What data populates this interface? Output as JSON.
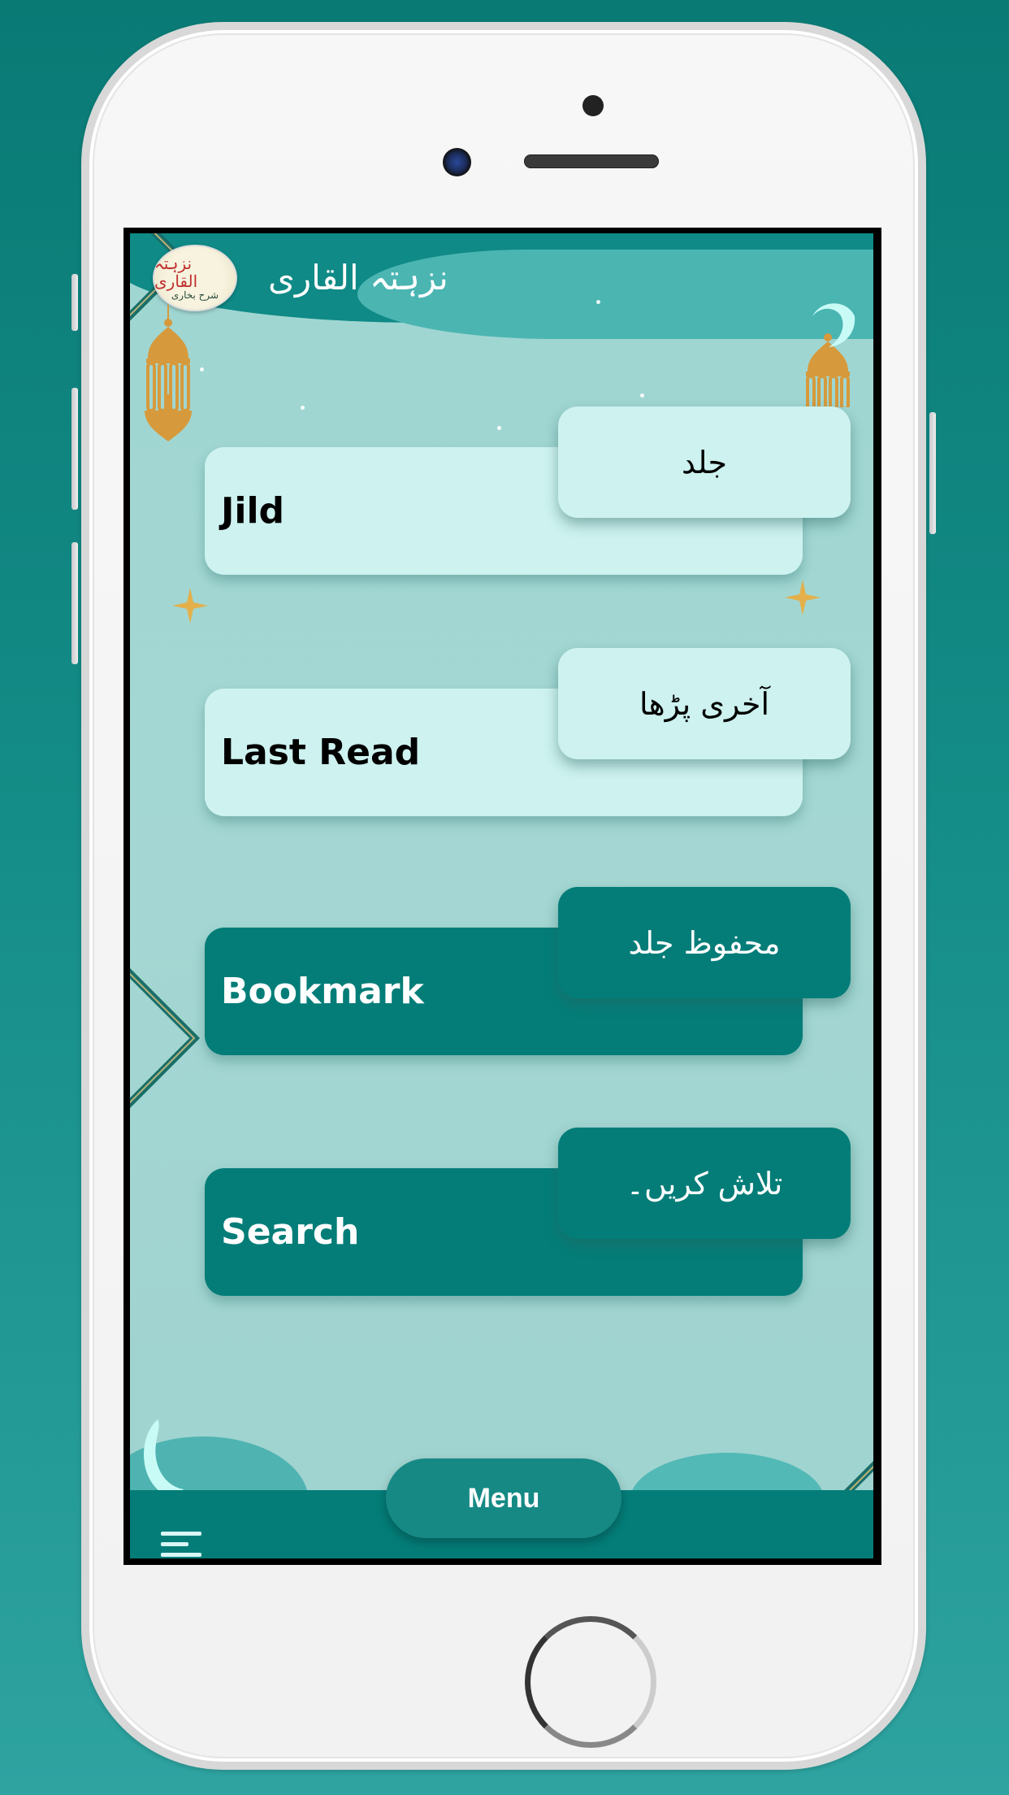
{
  "device": {
    "frame": "iPhone mockup",
    "background_colors": [
      "#0a7a75",
      "#2ea3a0"
    ]
  },
  "app": {
    "title_urdu": "نزہتہ القاری",
    "logo": {
      "line1": "نزہتہ القاری",
      "line2": "شرح بخاری"
    }
  },
  "menu_cards": [
    {
      "label_en": "Jild",
      "label_ur": "جلد",
      "style": "light"
    },
    {
      "label_en": "Last Read",
      "label_ur": "آخری پڑھا",
      "style": "light"
    },
    {
      "label_en": "Bookmark",
      "label_ur": "محفوظ جلد",
      "style": "dark"
    },
    {
      "label_en": "Search",
      "label_ur": "تلاش کریں۔",
      "style": "dark"
    }
  ],
  "bottom_nav": {
    "menu_label": "Menu",
    "hamburger_icon": "menu-lines-icon"
  },
  "colors": {
    "card_light": "#cdf2ef",
    "card_dark": "#047d78",
    "screen_bg": "#a2d6d2",
    "accent_gold": "#d69a3c",
    "bottom_bar": "#047d78"
  }
}
